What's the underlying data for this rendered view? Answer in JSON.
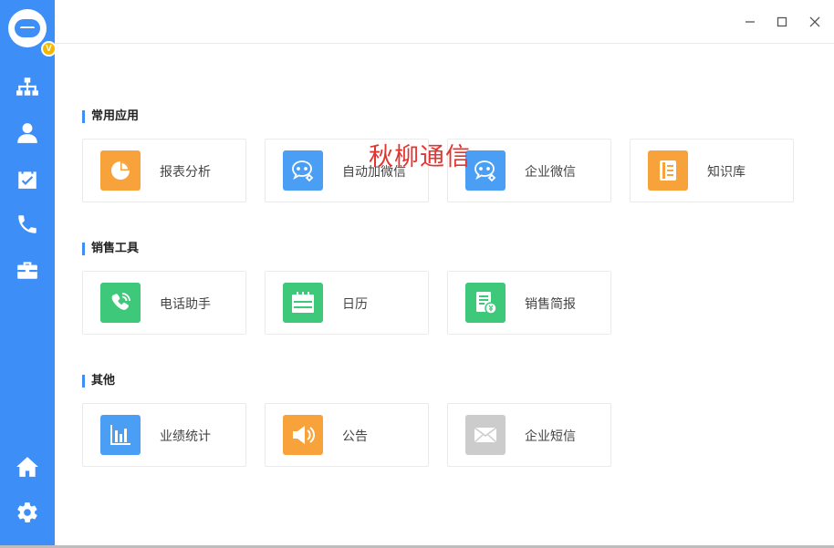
{
  "sidebar": {
    "vip_badge": "V",
    "nav": [
      {
        "icon": "org-structure-icon"
      },
      {
        "icon": "contact-icon"
      },
      {
        "icon": "calendar-check-icon"
      },
      {
        "icon": "phone-icon"
      },
      {
        "icon": "toolbox-icon"
      }
    ],
    "bottom": [
      {
        "icon": "home-icon"
      },
      {
        "icon": "settings-icon"
      }
    ]
  },
  "window_controls": [
    "minimize",
    "maximize",
    "close"
  ],
  "watermark": "秋柳通信",
  "sections": [
    {
      "title": "常用应用",
      "apps": [
        {
          "label": "报表分析",
          "icon": "pie-chart-icon",
          "color": "#f7a23b"
        },
        {
          "label": "自动加微信",
          "icon": "wechat-add-icon",
          "color": "#4a9ff5"
        },
        {
          "label": "企业微信",
          "icon": "wechat-work-icon",
          "color": "#4a9ff5"
        },
        {
          "label": "知识库",
          "icon": "knowledge-book-icon",
          "color": "#f7a23b"
        }
      ]
    },
    {
      "title": "销售工具",
      "apps": [
        {
          "label": "电话助手",
          "icon": "phone-assistant-icon",
          "color": "#3ec97a"
        },
        {
          "label": "日历",
          "icon": "calendar-icon",
          "color": "#3ec97a"
        },
        {
          "label": "销售简报",
          "icon": "sales-report-icon",
          "color": "#3ec97a"
        }
      ]
    },
    {
      "title": "其他",
      "apps": [
        {
          "label": "业绩统计",
          "icon": "bar-chart-icon",
          "color": "#4a9ff5"
        },
        {
          "label": "公告",
          "icon": "announcement-speaker-icon",
          "color": "#f7a23b"
        },
        {
          "label": "企业短信",
          "icon": "sms-envelope-icon",
          "color": "#cccccc"
        }
      ]
    }
  ]
}
